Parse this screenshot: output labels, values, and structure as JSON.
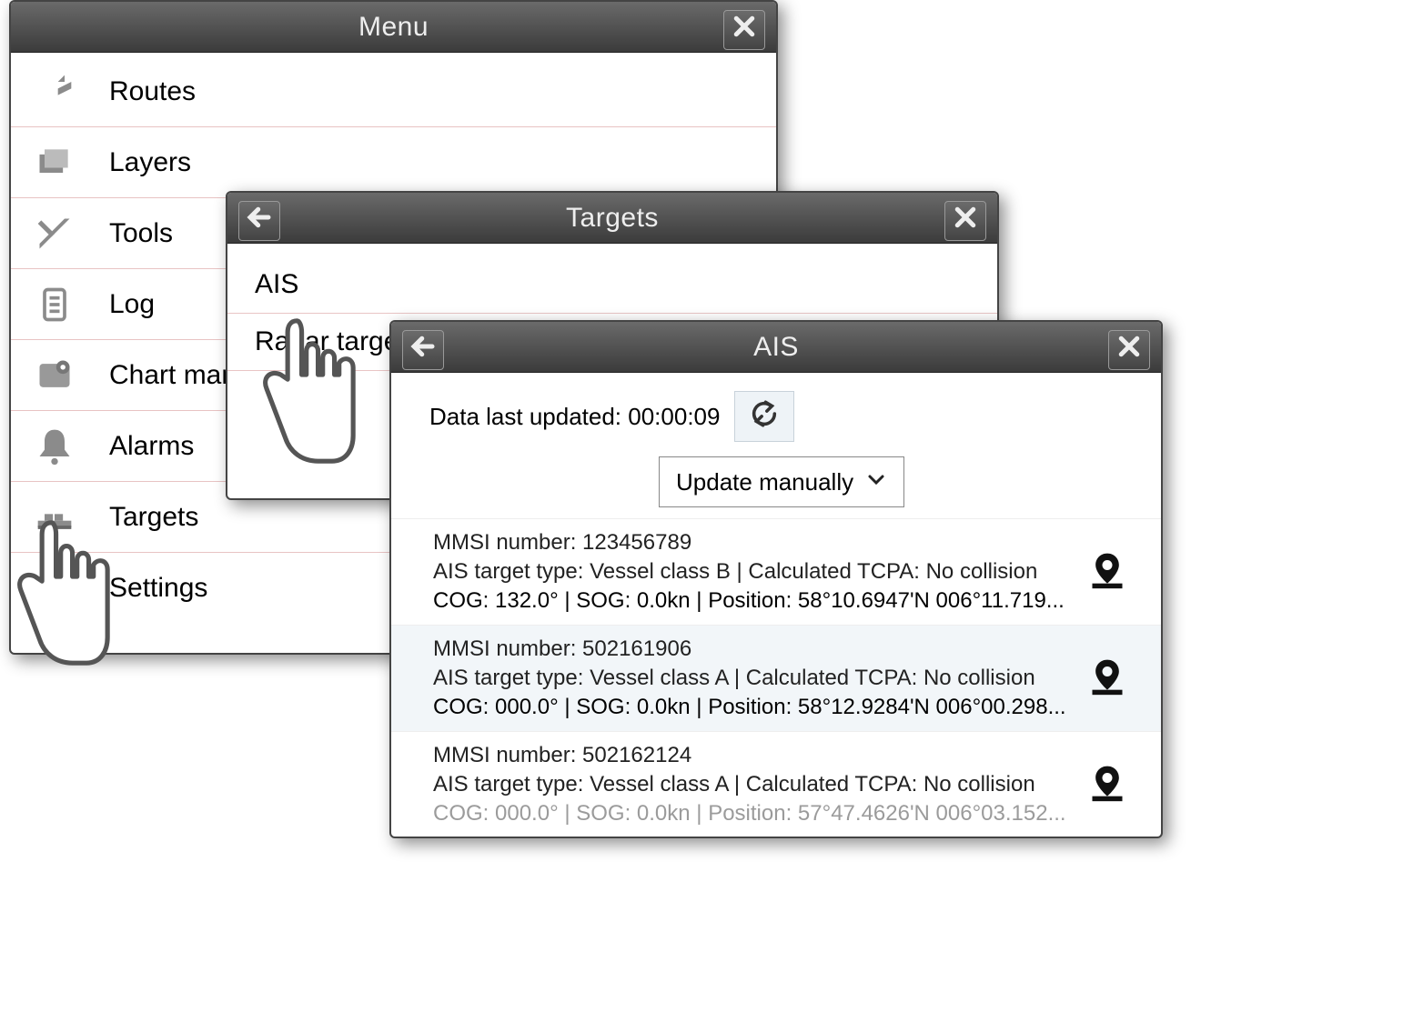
{
  "menu": {
    "title": "Menu",
    "items": [
      {
        "label": "Routes"
      },
      {
        "label": "Layers"
      },
      {
        "label": "Tools"
      },
      {
        "label": "Log"
      },
      {
        "label": "Chart management"
      },
      {
        "label": "Alarms"
      },
      {
        "label": "Targets"
      },
      {
        "label": "Settings"
      }
    ]
  },
  "targets": {
    "title": "Targets",
    "items": [
      {
        "label": "AIS"
      },
      {
        "label": "Radar targets"
      }
    ]
  },
  "ais": {
    "title": "AIS",
    "updated_label": "Data last updated: 00:00:09",
    "update_mode": "Update manually",
    "rows": [
      {
        "line1": "MMSI number: 123456789",
        "line2": "AIS target type: Vessel class B | Calculated TCPA: No collision",
        "line3": "COG: 132.0° | SOG: 0.0kn | Position: 58°10.6947'N 006°11.719..."
      },
      {
        "line1": "MMSI number: 502161906",
        "line2": "AIS target type: Vessel class A | Calculated TCPA: No collision",
        "line3": "COG: 000.0° | SOG: 0.0kn | Position: 58°12.9284'N 006°00.298..."
      },
      {
        "line1": "MMSI number: 502162124",
        "line2": "AIS target type: Vessel class A | Calculated TCPA: No collision",
        "line3": "COG: 000.0° | SOG: 0.0kn | Position: 57°47.4626'N 006°03.152..."
      }
    ]
  }
}
